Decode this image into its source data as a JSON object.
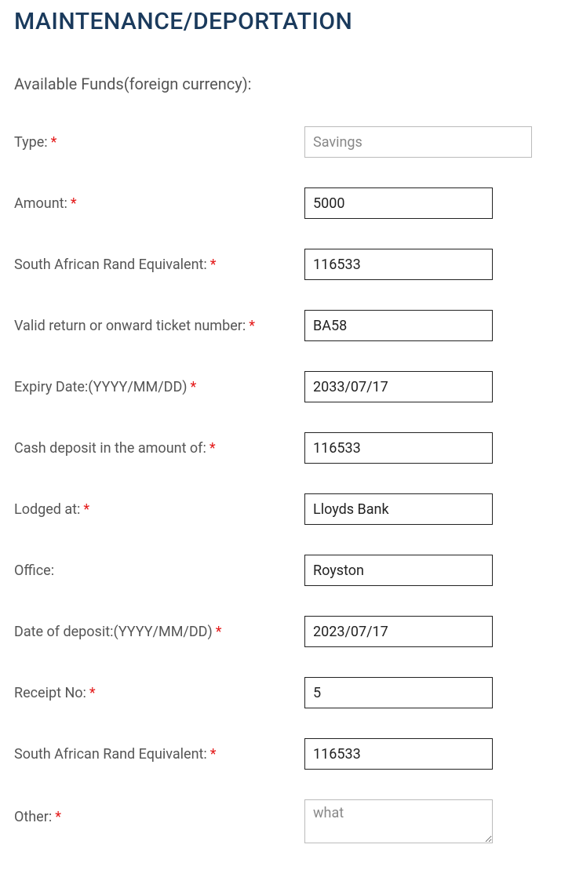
{
  "title": "MAINTENANCE/DEPORTATION",
  "section_label": "Available Funds(foreign currency):",
  "fields": {
    "type": {
      "label": "Type:",
      "value": "Savings",
      "required": true
    },
    "amount": {
      "label": "Amount:",
      "value": "5000",
      "required": true
    },
    "rand_equiv1": {
      "label": "South African Rand Equivalent:",
      "value": "116533",
      "required": true
    },
    "ticket_number": {
      "label": "Valid return or onward ticket number:",
      "value": "BA58",
      "required": true
    },
    "expiry_date": {
      "label": "Expiry Date:(YYYY/MM/DD)",
      "value": "2033/07/17",
      "required": true
    },
    "cash_deposit": {
      "label": "Cash deposit in the amount of:",
      "value": "116533",
      "required": true
    },
    "lodged_at": {
      "label": "Lodged at:",
      "value": "Lloyds Bank",
      "required": true
    },
    "office": {
      "label": "Office:",
      "value": "Royston",
      "required": false
    },
    "deposit_date": {
      "label": "Date of deposit:(YYYY/MM/DD)",
      "value": "2023/07/17",
      "required": true
    },
    "receipt_no": {
      "label": "Receipt No:",
      "value": "5",
      "required": true
    },
    "rand_equiv2": {
      "label": "South African Rand Equivalent:",
      "value": "116533",
      "required": true
    },
    "other": {
      "label": "Other:",
      "value": "what",
      "required": true
    }
  },
  "required_marker": "*"
}
